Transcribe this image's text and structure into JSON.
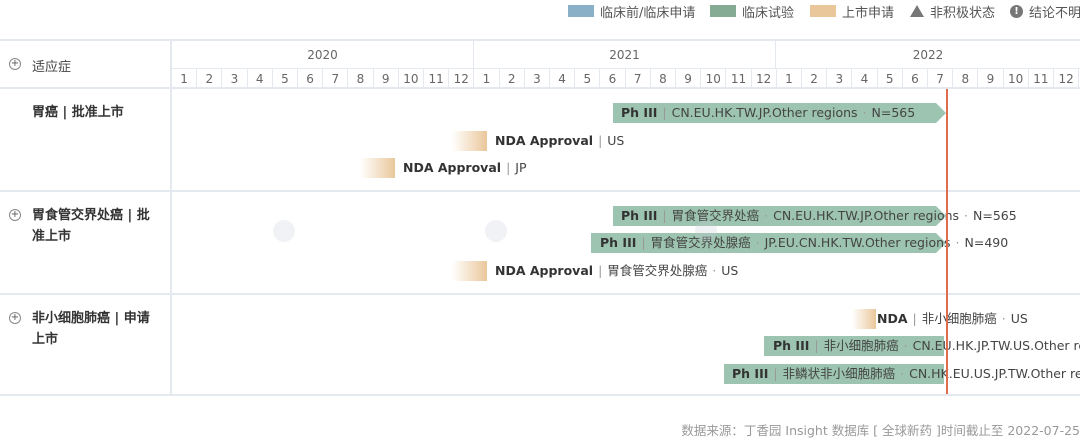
{
  "legend": {
    "preclinical": "临床前/临床申请",
    "clinical": "临床试验",
    "listing": "上市申请",
    "inactive": "非积极状态",
    "unclear": "结论不明"
  },
  "colors": {
    "preclinical": "#8ab0c8",
    "clinical": "#86ab94",
    "listing": "#eac79b",
    "today": "#e06c4c"
  },
  "header": {
    "title": "适应症"
  },
  "years": [
    "2020",
    "2021",
    "2022"
  ],
  "months": [
    "1",
    "2",
    "3",
    "4",
    "5",
    "6",
    "7",
    "8",
    "9",
    "10",
    "11",
    "12",
    "1",
    "2",
    "3",
    "4",
    "5",
    "6",
    "7",
    "8",
    "9",
    "10",
    "11",
    "12",
    "1",
    "2",
    "3",
    "4",
    "5",
    "6",
    "7",
    "8",
    "9",
    "10",
    "11",
    "12"
  ],
  "sections": [
    {
      "label": "胃癌 | 批准上市",
      "rows": [
        {
          "phase": "Ph III",
          "detail": "CN.EU.HK.TW.JP.Other regions",
          "n": "N=565"
        },
        {
          "phase": "NDA Approval",
          "detail": "US"
        },
        {
          "phase": "NDA Approval",
          "detail": "JP"
        }
      ]
    },
    {
      "label": "胃食管交界处癌 | 批准上市",
      "rows": [
        {
          "phase": "Ph III",
          "indication": "胃食管交界处癌",
          "detail": "CN.EU.HK.TW.JP.Other regions",
          "n": "N=565"
        },
        {
          "phase": "Ph III",
          "indication": "胃食管交界处腺癌",
          "detail": "JP.EU.CN.HK.TW.Other regions",
          "n": "N=490"
        },
        {
          "phase": "NDA Approval",
          "indication": "胃食管交界处腺癌",
          "detail": "US"
        }
      ]
    },
    {
      "label": "非小细胞肺癌 | 申请上市",
      "rows": [
        {
          "phase": "NDA",
          "indication": "非小细胞肺癌",
          "detail": "US"
        },
        {
          "phase": "Ph III",
          "indication": "非小细胞肺癌",
          "detail": "CN.EU.HK.JP.TW.US.Other re"
        },
        {
          "phase": "Ph III",
          "indication": "非鳞状非小细胞肺癌",
          "detail": "CN.HK.EU.US.JP.TW.Other re"
        }
      ]
    }
  ],
  "footer": "数据来源：丁香园 Insight 数据库 [ 全球新药 ]时间截止至 2022-07-25"
}
